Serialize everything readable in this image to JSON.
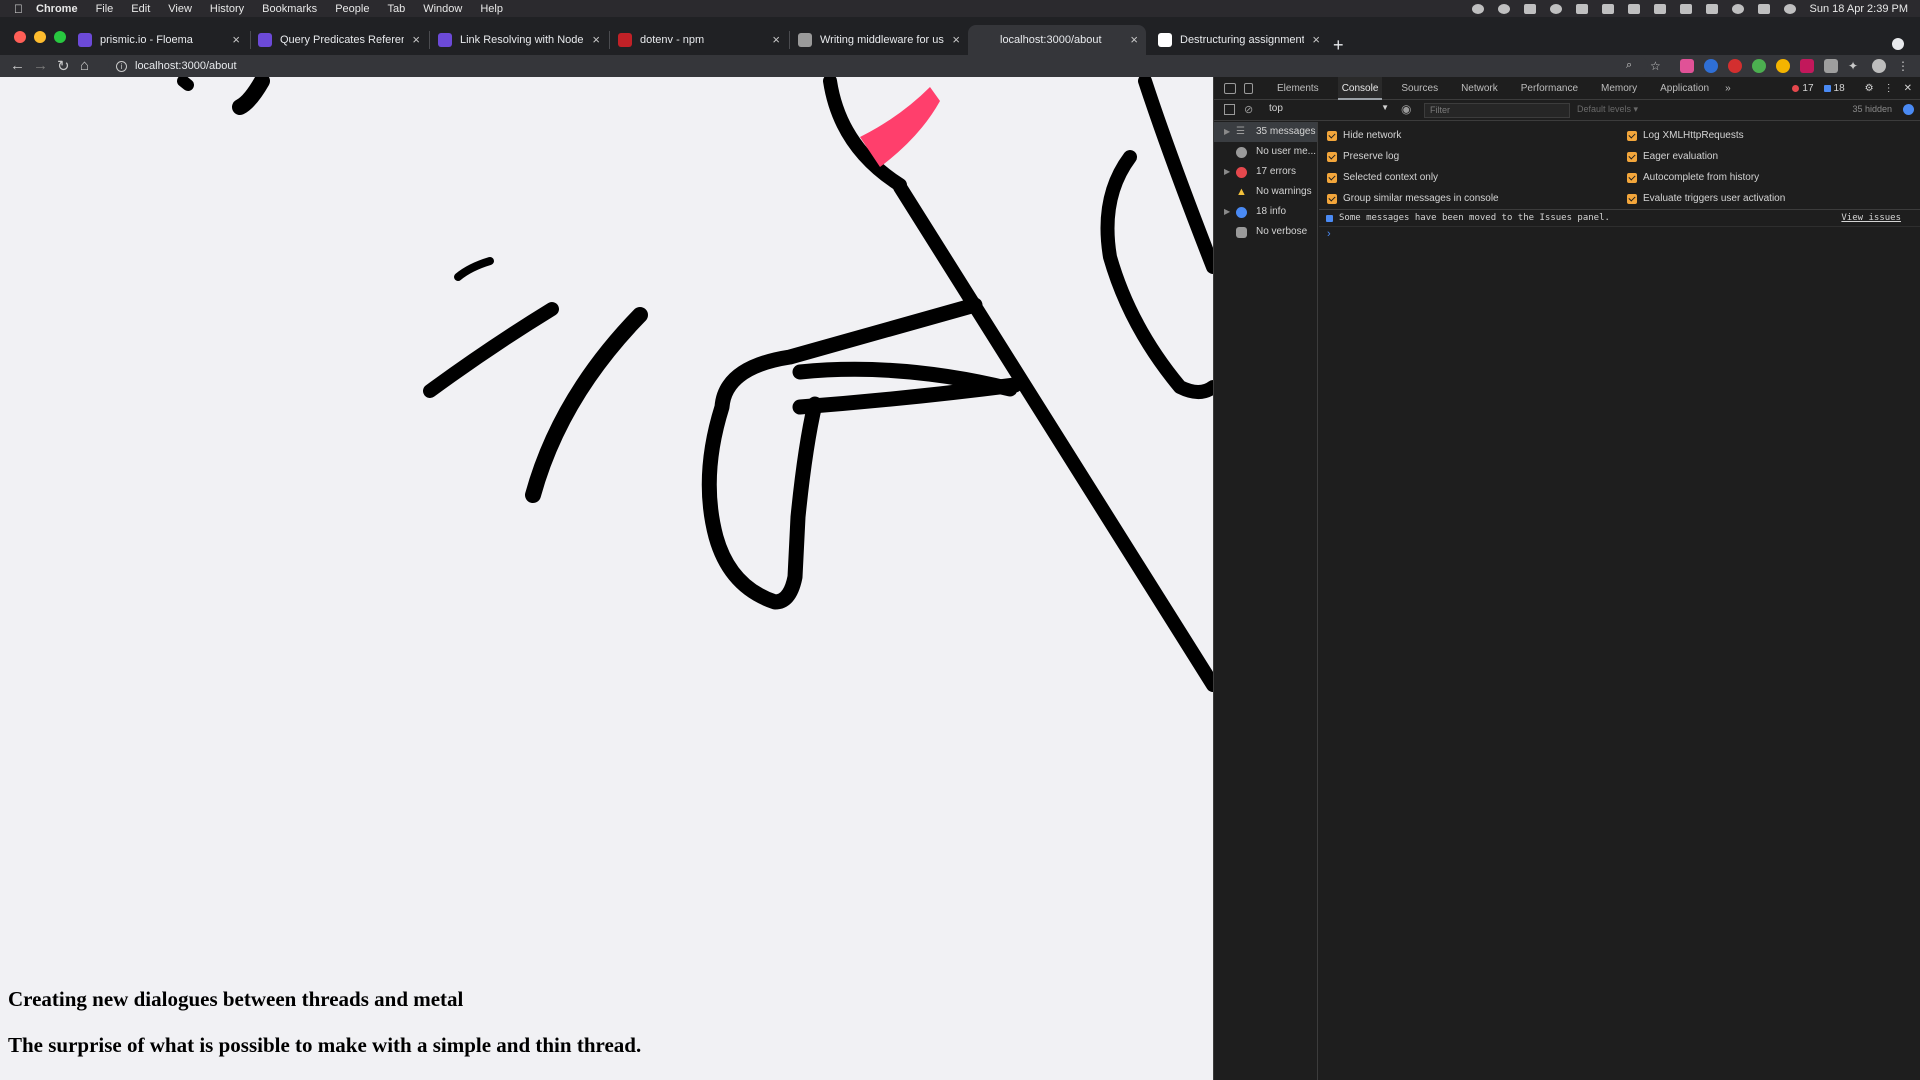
{
  "menubar": {
    "app": "Chrome",
    "items": [
      "File",
      "Edit",
      "View",
      "History",
      "Bookmarks",
      "People",
      "Tab",
      "Window",
      "Help"
    ],
    "clock": "Sun 18 Apr  2:39 PM"
  },
  "tabs": [
    {
      "label": "prismic.io - Floema",
      "favicon_color": "#6c4ad8"
    },
    {
      "label": "Query Predicates Reference fo",
      "favicon_color": "#6c4ad8"
    },
    {
      "label": "Link Resolving with Node.js - P",
      "favicon_color": "#6c4ad8"
    },
    {
      "label": "dotenv - npm",
      "favicon_color": "#c12127"
    },
    {
      "label": "Writing middleware for use in E",
      "favicon_color": "#9a9a9a"
    },
    {
      "label": "localhost:3000/about",
      "favicon_color": "#35363a",
      "active": true
    },
    {
      "label": "Destructuring assignment - Jav",
      "favicon_color": "#ffffff"
    }
  ],
  "address_bar": {
    "url": "localhost:3000/about"
  },
  "page": {
    "heading_1": "Creating new dialogues between threads and metal",
    "heading_2": "The surprise of what is possible to make with a simple and thin thread.",
    "accent_color": "#ff3f6c"
  },
  "devtools": {
    "tabs": [
      "Elements",
      "Console",
      "Sources",
      "Network",
      "Performance",
      "Memory",
      "Application"
    ],
    "active_tab": "Console",
    "error_count": "17",
    "info_count": "18",
    "context": "top",
    "filter_placeholder": "Filter",
    "levels": "Default levels",
    "hidden": "35 hidden",
    "sidebar": [
      {
        "label": "35 messages",
        "icon": "list-icon",
        "expandable": true
      },
      {
        "label": "No user me...",
        "icon": "user-icon",
        "expandable": false
      },
      {
        "label": "17 errors",
        "icon": "error-icon",
        "expandable": true
      },
      {
        "label": "No warnings",
        "icon": "warning-icon",
        "expandable": false
      },
      {
        "label": "18 info",
        "icon": "info-icon",
        "expandable": true
      },
      {
        "label": "No verbose",
        "icon": "bug-icon",
        "expandable": false
      }
    ],
    "settings_left": [
      "Hide network",
      "Preserve log",
      "Selected context only",
      "Group similar messages in console"
    ],
    "settings_right": [
      "Log XMLHttpRequests",
      "Eager evaluation",
      "Autocomplete from history",
      "Evaluate triggers user activation"
    ],
    "message": "Some messages have been moved to the Issues panel.",
    "message_link": "View issues",
    "prompt": "›"
  }
}
